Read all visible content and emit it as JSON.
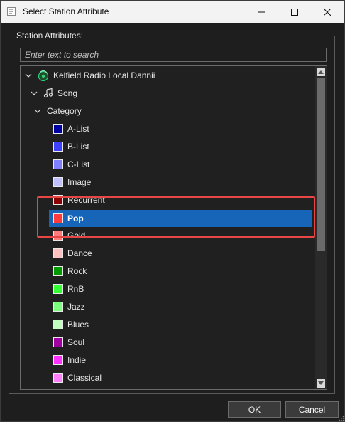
{
  "window": {
    "title": "Select Station Attribute",
    "controls": [
      "minimize-icon",
      "maximize-icon",
      "close-icon"
    ]
  },
  "group": {
    "legend": "Station Attributes:"
  },
  "search": {
    "placeholder": "Enter text to search",
    "value": ""
  },
  "tree": {
    "station": {
      "label": "Kelfield Radio Local Dannii",
      "icon": "station-icon"
    },
    "song": {
      "label": "Song",
      "icon": "music-note-icon"
    },
    "category": {
      "label": "Category"
    },
    "items": [
      {
        "label": "A-List",
        "color": "#0000a0"
      },
      {
        "label": "B-List",
        "color": "#4040ff"
      },
      {
        "label": "C-List",
        "color": "#8080ff"
      },
      {
        "label": "Image",
        "color": "#c0c0ff"
      },
      {
        "label": "Recurrent",
        "color": "#8b0000"
      },
      {
        "label": "Pop",
        "color": "#ff3b3b",
        "selected": true
      },
      {
        "label": "Gold",
        "color": "#ff7b7b"
      },
      {
        "label": "Dance",
        "color": "#ffc0c0"
      },
      {
        "label": "Rock",
        "color": "#009900"
      },
      {
        "label": "RnB",
        "color": "#33ff33"
      },
      {
        "label": "Jazz",
        "color": "#7dff7d"
      },
      {
        "label": "Blues",
        "color": "#c0ffc0"
      },
      {
        "label": "Soul",
        "color": "#a000a0"
      },
      {
        "label": "Indie",
        "color": "#ff33ff"
      },
      {
        "label": "Classical",
        "color": "#ff80ff"
      }
    ]
  },
  "colors": {
    "selection": "#1665b8",
    "highlight_box": "#e84545"
  },
  "buttons": {
    "ok": "OK",
    "cancel": "Cancel"
  }
}
